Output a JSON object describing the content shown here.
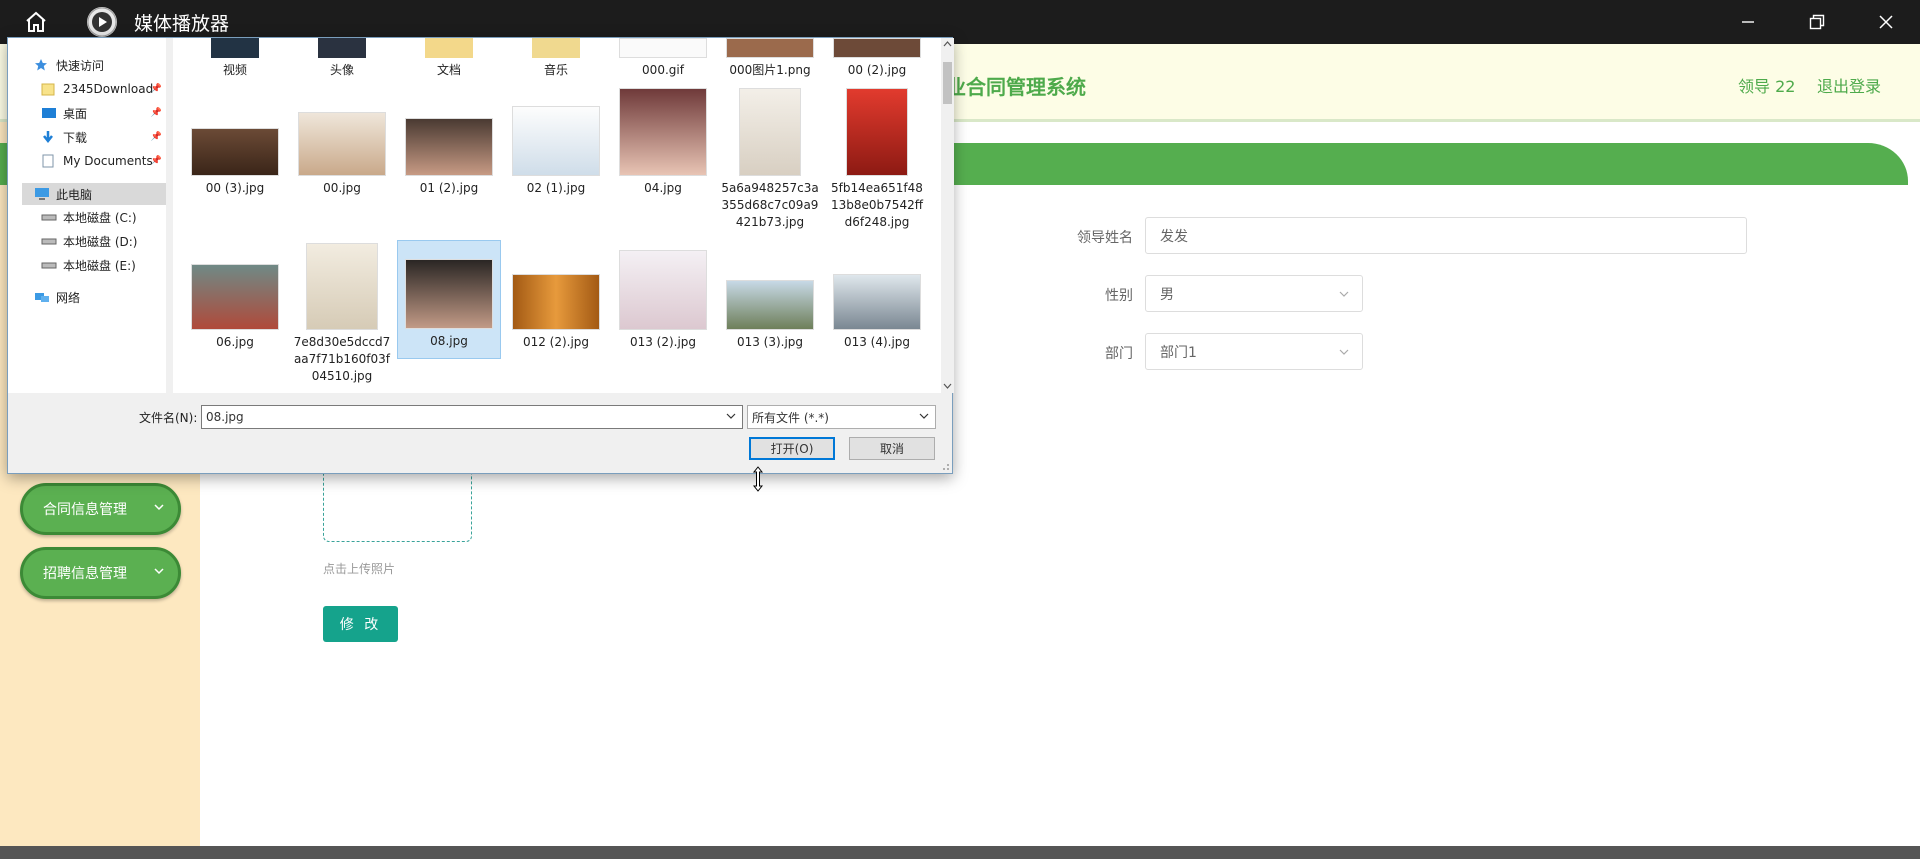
{
  "window": {
    "title": "媒体播放器",
    "home_icon": "home-icon",
    "app_icon": "play-icon"
  },
  "app": {
    "header_title": "业合同管理系统",
    "user": "领导 22",
    "logout": "退出登录",
    "sidebar": [
      {
        "label": "合同信息管理"
      },
      {
        "label": "招聘信息管理"
      }
    ],
    "form": {
      "name_label": "领导姓名",
      "name_placeholder": "发发",
      "gender_label": "性别",
      "gender_value": "男",
      "dept_label": "部门",
      "dept_value": "部门1",
      "upload_hint": "点击上传照片",
      "submit": "修 改"
    }
  },
  "dialog": {
    "nav": {
      "quick_access": "快速访问",
      "items": [
        "2345Download",
        "桌面",
        "下载",
        "My Documents"
      ],
      "this_pc": "此电脑",
      "drives": [
        "本地磁盘 (C:)",
        "本地磁盘 (D:)",
        "本地磁盘 (E:)"
      ],
      "network": "网络"
    },
    "files_row0": [
      "视频",
      "头像",
      "文档",
      "音乐",
      "000.gif",
      "000图片1.png",
      "00 (2).jpg"
    ],
    "files_row1": [
      "00 (3).jpg",
      "00.jpg",
      "01 (2).jpg",
      "02 (1).jpg",
      "04.jpg",
      "5a6a948257c3a355d68c7c09a9421b73.jpg",
      "5fb14ea651f4813b8e0b7542ffd6f248.jpg"
    ],
    "files_row2": [
      "06.jpg",
      "7e8d30e5dccd7aa7f71b160f03f04510.jpg",
      "08.jpg",
      "012 (2).jpg",
      "013 (2).jpg",
      "013 (3).jpg",
      "013 (4).jpg"
    ],
    "selected_file": "08.jpg",
    "filename_label": "文件名(N):",
    "filename_value": "08.jpg",
    "filter_value": "所有文件 (*.*)",
    "open_button": "打开(O)",
    "cancel_button": "取消"
  },
  "colors": {
    "accent_green": "#55ae4f",
    "teal_button": "#15a38c",
    "sidebar_bg": "#fde8c0",
    "header_bg": "#fdfde6"
  }
}
